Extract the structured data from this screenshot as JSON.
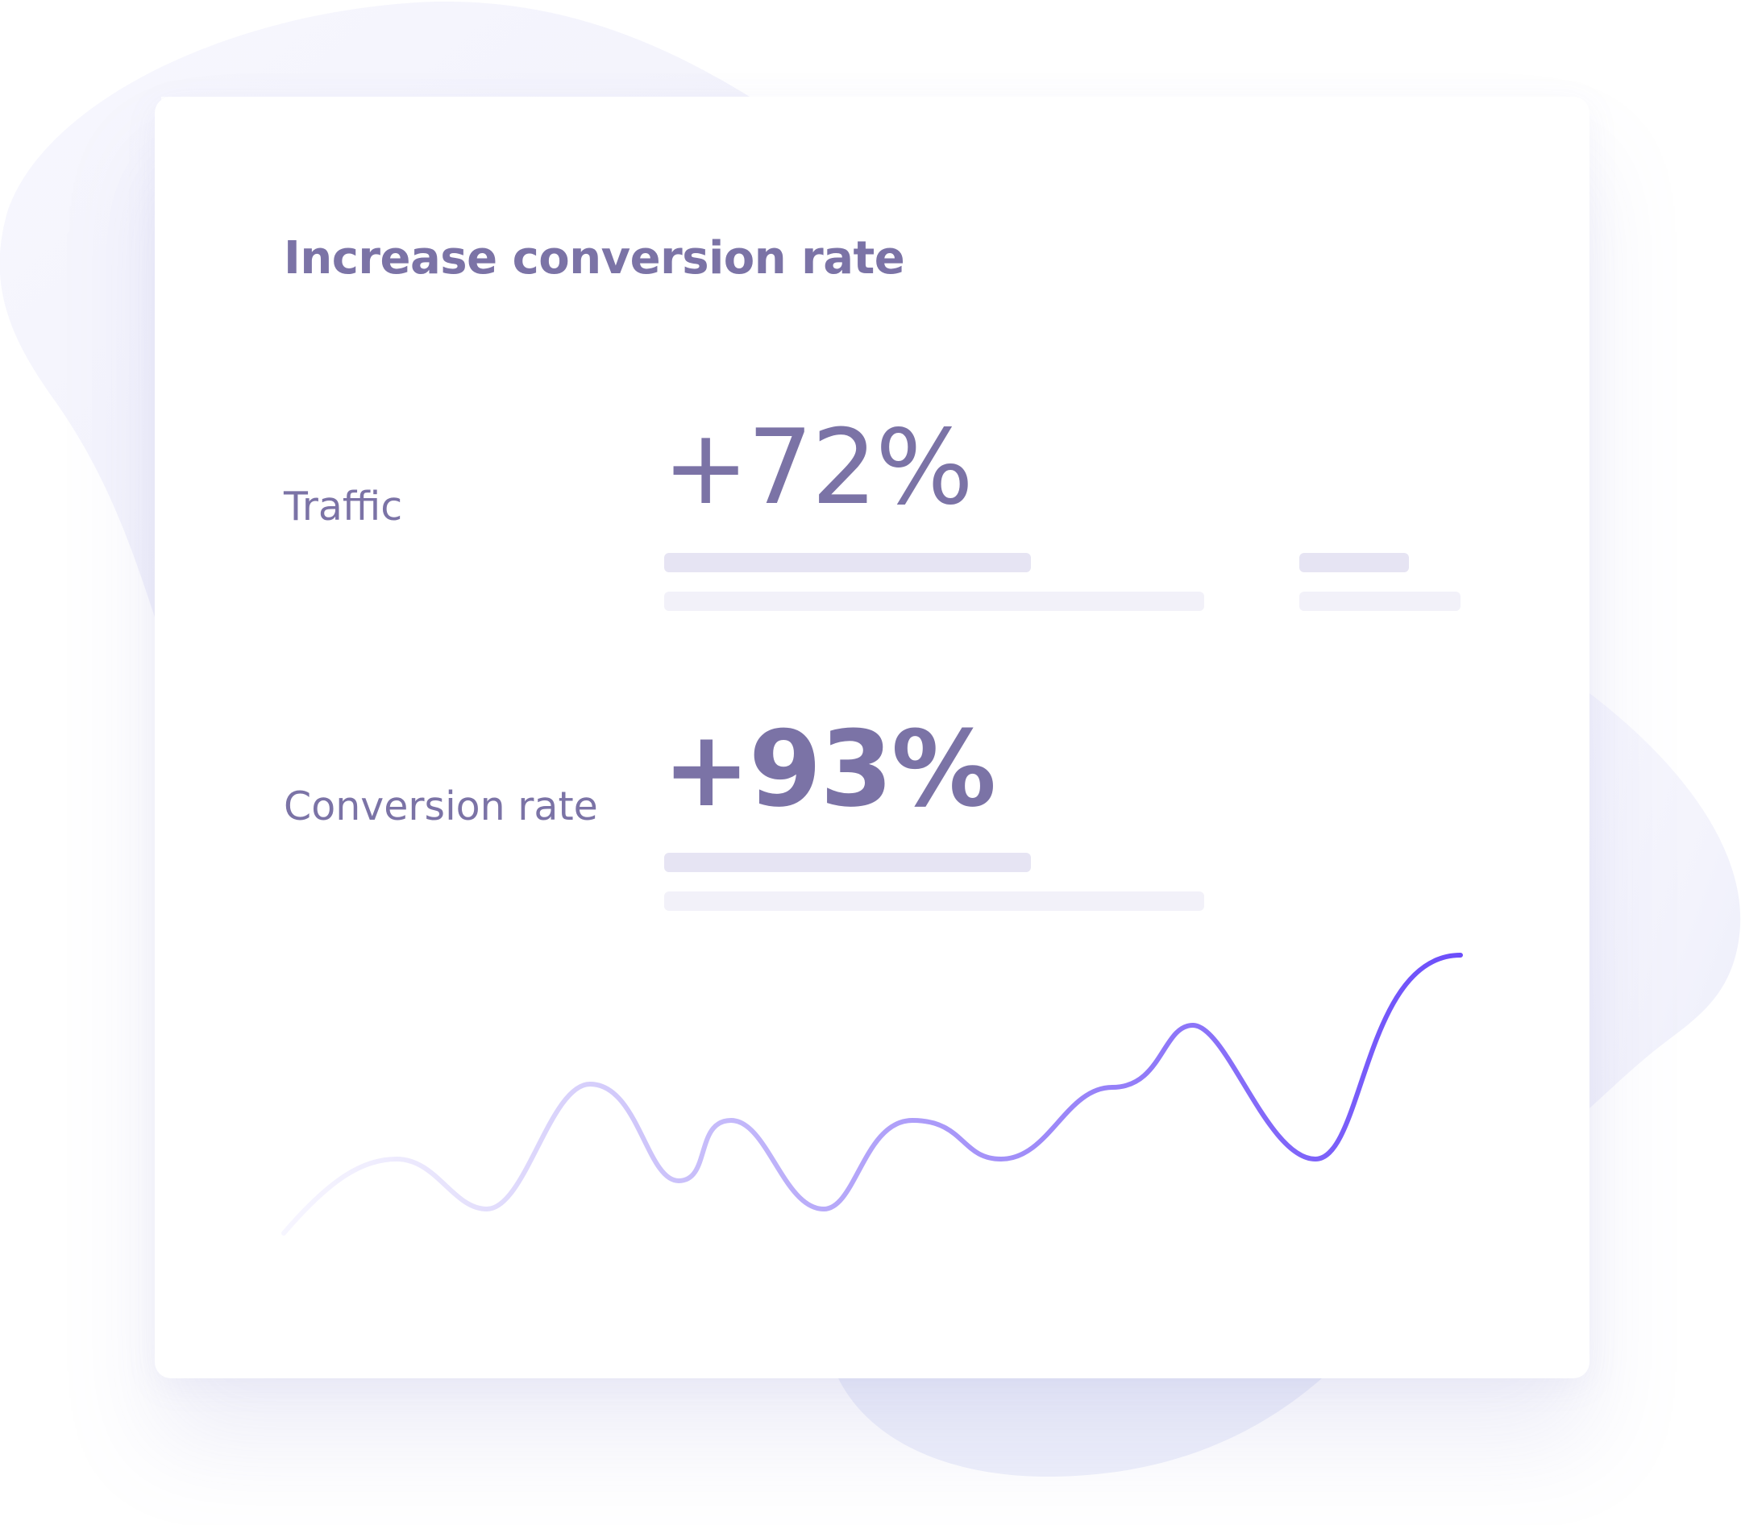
{
  "card": {
    "title": "Increase conversion rate"
  },
  "metrics": [
    {
      "label": "Traffic",
      "value": "+72%"
    },
    {
      "label": "Conversion rate",
      "value": "+93%"
    }
  ],
  "colors": {
    "text": "#7b73a6",
    "bar_dark": "#e6e4f3",
    "bar_light": "#f2f1f9",
    "line_start": "#e9e6fb",
    "line_end": "#6b4dfa",
    "blob": "#f4f3fd"
  }
}
